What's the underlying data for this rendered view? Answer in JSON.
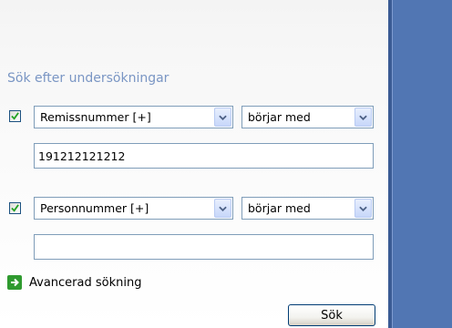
{
  "search": {
    "heading": "Sök efter undersökningar",
    "row1": {
      "checked": true,
      "field": "Remissnummer [+]",
      "operator": "börjar med",
      "value": "191212121212"
    },
    "row2": {
      "checked": true,
      "field": "Personnummer [+]",
      "operator": "börjar med",
      "value": ""
    },
    "advanced_label": "Avancerad sökning",
    "search_button": "Sök"
  },
  "colors": {
    "heading": "#7a96c4",
    "right_pane": "#5176b3",
    "checkbox_border": "#1c5180",
    "check_mark": "#21a121",
    "advanced_icon": "#2f9a2f"
  },
  "icons": {
    "checkbox": "check-mark",
    "dropdown": "chevron-down",
    "advanced": "green-arrow-right"
  }
}
